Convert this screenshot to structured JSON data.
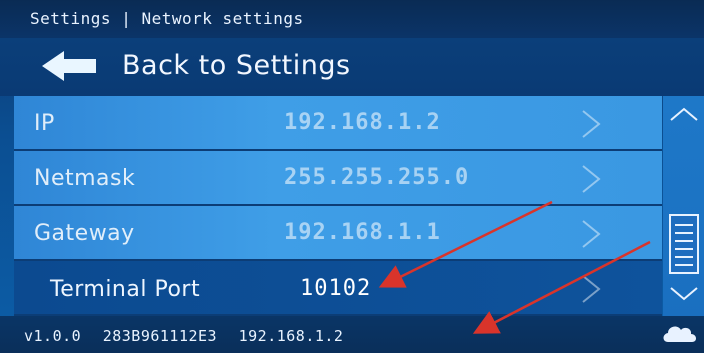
{
  "header": {
    "title": "Settings | Network settings"
  },
  "back": {
    "label": "Back to Settings",
    "icon": "back-arrow-icon"
  },
  "rows": [
    {
      "label": "IP",
      "value": "192.168.1.2"
    },
    {
      "label": "Netmask",
      "value": "255.255.255.0"
    },
    {
      "label": "Gateway",
      "value": "192.168.1.1"
    },
    {
      "label": "Terminal Port",
      "value": "10102"
    }
  ],
  "status": {
    "version": "v1.0.0",
    "device_id": "283B961112E3",
    "ip": "192.168.1.2"
  },
  "colors": {
    "row_bg": "#3a98e2",
    "highlight_row_bg": "#0e539c",
    "annotation_arrow": "#d9342b"
  }
}
